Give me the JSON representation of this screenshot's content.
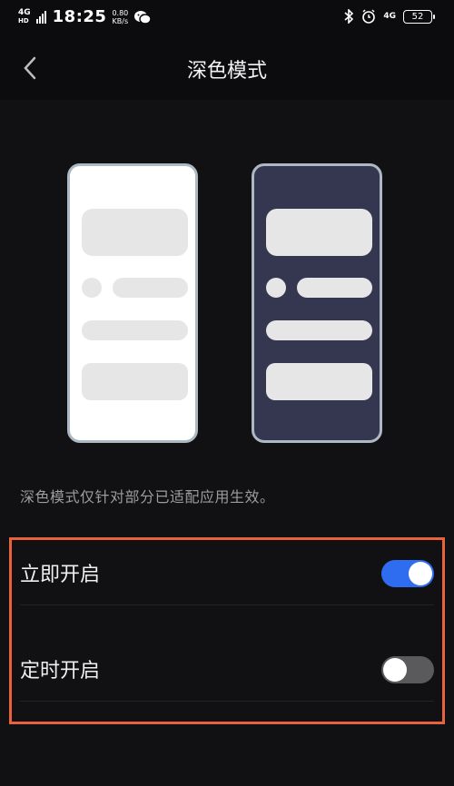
{
  "status_bar": {
    "network_type": "4G",
    "network_hd": "HD",
    "time": "18:25",
    "speed_value": "0.80",
    "speed_unit": "KB/s",
    "right_network": "4G",
    "battery": "52"
  },
  "header": {
    "title": "深色模式"
  },
  "description": "深色模式仅针对部分已适配应用生效。",
  "settings": [
    {
      "label": "立即开启",
      "enabled": true
    },
    {
      "label": "定时开启",
      "enabled": false
    }
  ],
  "colors": {
    "background": "#0c0c0e",
    "toggle_on": "#2f6df0",
    "toggle_off": "#5a5a5c",
    "highlight_border": "#e8623e",
    "dark_preview": "#353650"
  }
}
